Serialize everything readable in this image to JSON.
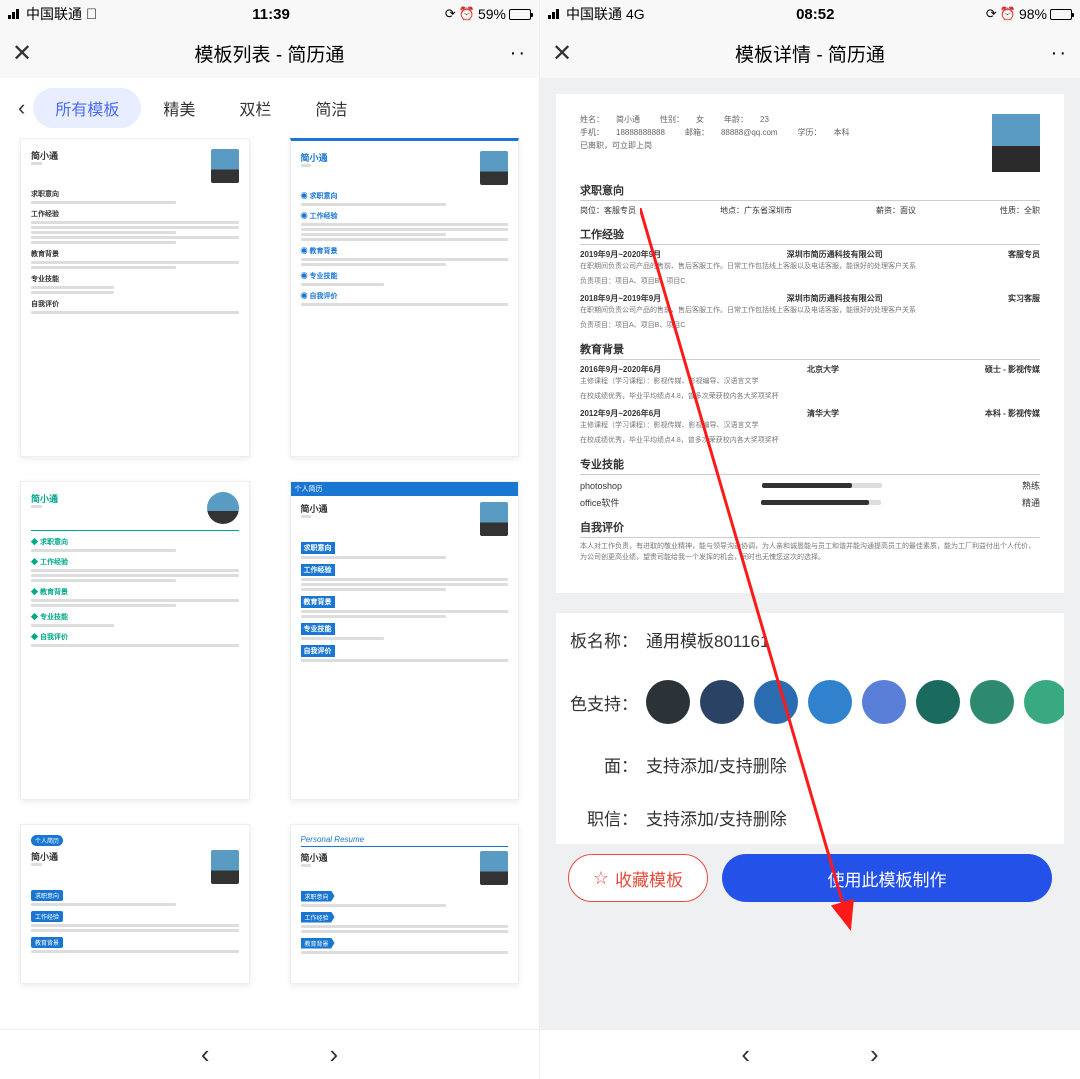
{
  "left": {
    "status": {
      "carrier": "中国联通",
      "time": "11:39",
      "battery": "59%"
    },
    "header": {
      "title": "模板列表 - 简历通",
      "close": "✕",
      "more": "··"
    },
    "tabs": {
      "back": "‹",
      "items": [
        "所有模板",
        "精美",
        "双栏",
        "简洁"
      ],
      "active_index": 0
    },
    "templates": [
      {
        "name": "简小通",
        "style": "green"
      },
      {
        "name": "简小通",
        "style": "blue-border"
      },
      {
        "name": "简小通",
        "style": "teal"
      },
      {
        "name": "简小通",
        "style": "blue-bar"
      },
      {
        "name": "简小通",
        "style": "blue-tag"
      },
      {
        "name": "简小通",
        "style": "blue-ribbon"
      }
    ],
    "nav": {
      "prev": "‹",
      "next": "›"
    }
  },
  "right": {
    "status": {
      "carrier": "中国联通",
      "network": "4G",
      "time": "08:52",
      "battery": "98%"
    },
    "header": {
      "title": "模板详情 - 简历通",
      "close": "✕",
      "more": "··"
    },
    "resume": {
      "info": {
        "name_label": "姓名：",
        "name": "简小通",
        "gender_label": "性别：",
        "gender": "女",
        "age_label": "年龄：",
        "age": "23",
        "phone_label": "手机：",
        "phone": "18888888888",
        "email_label": "邮箱：",
        "email": "88888@qq.com",
        "degree_label": "学历：",
        "degree": "本科",
        "status": "已离职，可立即上岗"
      },
      "sections": {
        "intention": {
          "heading": "求职意向",
          "position_label": "岗位：",
          "position": "客服专员",
          "location_label": "地点：",
          "location": "广东省深圳市",
          "salary_label": "薪资：",
          "salary": "面议",
          "type_label": "性质：",
          "type": "全职"
        },
        "experience": {
          "heading": "工作经验",
          "items": [
            {
              "period": "2019年9月~2020年9月",
              "company": "深圳市简历通科技有限公司",
              "role": "客服专员",
              "desc": "在职期间负责公司产品的售前、售后客服工作。日常工作包括线上客服以及电话客服，能很好的处理客户关系",
              "tasks": "负责项目：项目A、项目B、项目C"
            },
            {
              "period": "2018年9月~2019年9月",
              "company": "深圳市简历通科技有限公司",
              "role": "实习客服",
              "desc": "在职期间负责公司产品的售前、售后客服工作。日常工作包括线上客服以及电话客服，能很好的处理客户关系",
              "tasks": "负责项目：项目A、项目B、项目C"
            }
          ]
        },
        "education": {
          "heading": "教育背景",
          "items": [
            {
              "period": "2016年9月~2020年6月",
              "school": "北京大学",
              "degree": "硕士 - 影视传媒",
              "courses": "主修课程（学习课程）：影视传媒、影视编导、汉语言文学",
              "honor": "在校成绩优秀，毕业平均绩点4.8，曾多次荣获校内各大奖项奖杯"
            },
            {
              "period": "2012年9月~2026年6月",
              "school": "清华大学",
              "degree": "本科 - 影视传媒",
              "courses": "主修课程（学习课程）：影视传媒、影视编导、汉语言文学",
              "honor": "在校成绩优秀，毕业平均绩点4.8，曾多次荣获校内各大奖项奖杯"
            }
          ]
        },
        "skills": {
          "heading": "专业技能",
          "items": [
            {
              "name": "photoshop",
              "level": "熟练",
              "pct": 75
            },
            {
              "name": "office软件",
              "level": "精通",
              "pct": 90
            }
          ]
        },
        "self_eval": {
          "heading": "自我评价",
          "text": "本人对工作负责，有进取的敬业精神，能与领导沟通协调，为人亲和诚恳能与员工和谐并能沟通提高员工的最佳素质，能为工厂利益付出个人代价，为公司创更高业绩，望贵司能给我一个发挥的机会，同时也无愧您这次的选择。"
        }
      }
    },
    "meta": {
      "name_label": "板名称：",
      "name_value": "通用模板801161",
      "color_label": "色支持：",
      "colors": [
        "#2c3338",
        "#2a4365",
        "#2b6cb0",
        "#3182ce",
        "#5a7fd8",
        "#1a6b5e",
        "#2d8a6f",
        "#38a981"
      ],
      "cover_label": "面：",
      "cover_value": "支持添加/支持删除",
      "letter_label": "职信：",
      "letter_value": "支持添加/支持删除"
    },
    "actions": {
      "favorite": "收藏模板",
      "use": "使用此模板制作"
    },
    "nav": {
      "prev": "‹",
      "next": "›"
    }
  }
}
